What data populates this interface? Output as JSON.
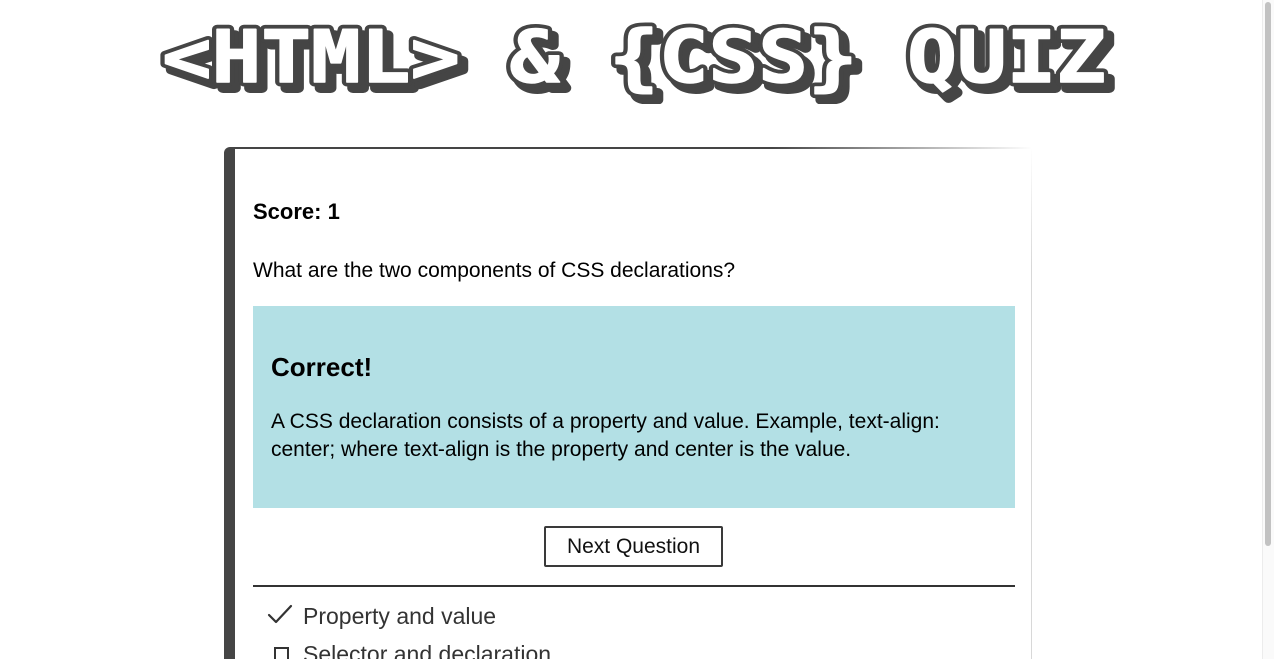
{
  "header": {
    "title": "<HTML> & {CSS} QUIZ"
  },
  "quiz": {
    "score_text": "Score: 1",
    "question": "What are the two components of CSS declarations?",
    "feedback": {
      "heading": "Correct!",
      "explanation": "A CSS declaration consists of a property and value. Example, text-align: center; where text-align is the property and center is the value."
    },
    "next_label": "Next Question",
    "answers": [
      {
        "label": "Property and value",
        "state": "checked"
      },
      {
        "label": "Selector and declaration",
        "state": "unchecked"
      }
    ]
  },
  "colors": {
    "feedback_bg": "#b3e0e5",
    "accent_dark": "#454545"
  },
  "icons": {
    "correct": "check-icon",
    "option": "checkbox-icon"
  }
}
